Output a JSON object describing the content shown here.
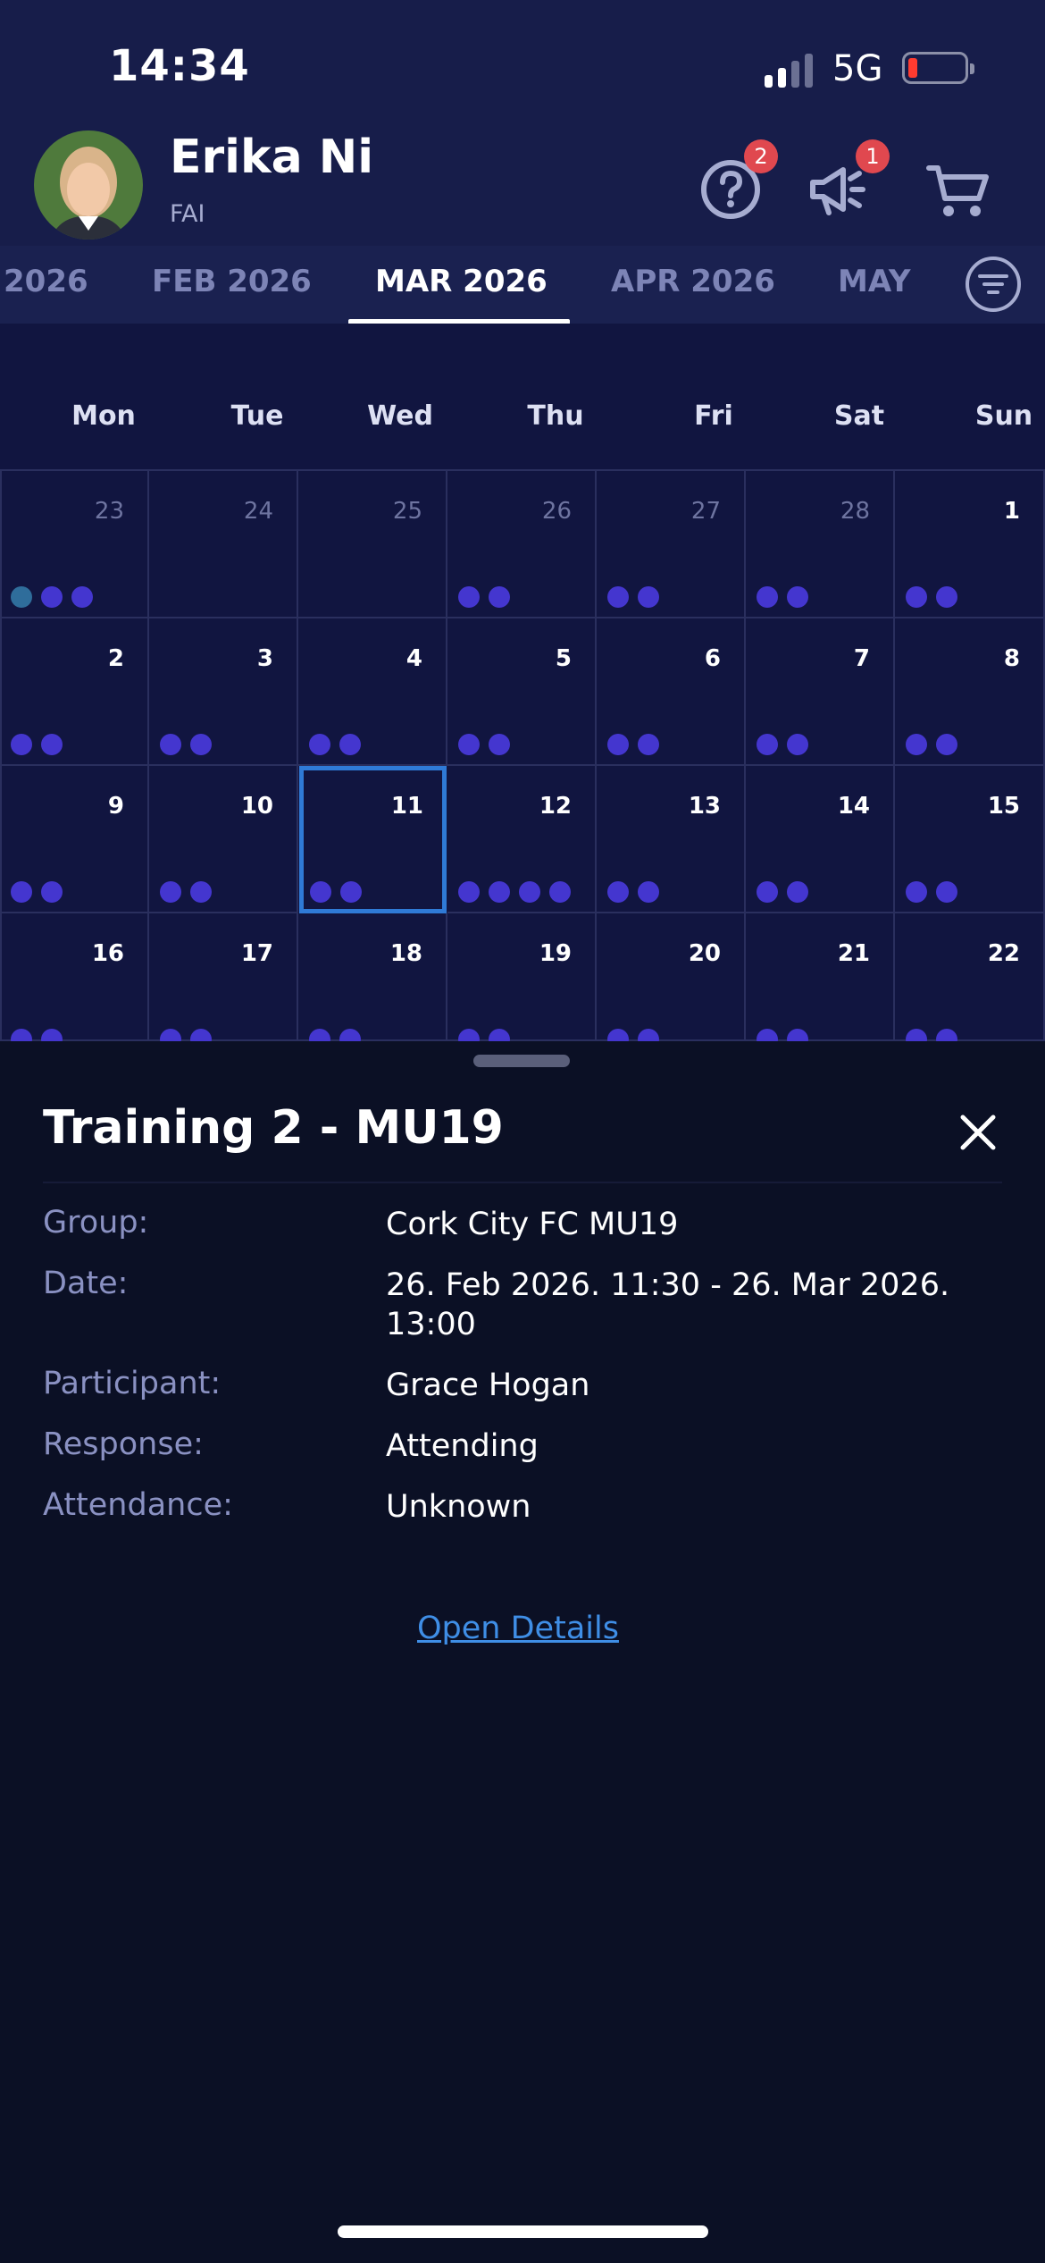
{
  "status_bar": {
    "time": "14:34",
    "network": "5G"
  },
  "user": {
    "name": "Erika Ni",
    "org": "FAI"
  },
  "header_icons": {
    "help_badge": "2",
    "announcements_badge": "1",
    "icons": [
      "help-circle-icon",
      "megaphone-icon",
      "cart-icon"
    ]
  },
  "months": [
    "2026",
    "FEB 2026",
    "MAR 2026",
    "APR 2026",
    "MAY"
  ],
  "active_month": "MAR 2026",
  "weekdays": [
    "Mon",
    "Tue",
    "Wed",
    "Thu",
    "Fri",
    "Sat",
    "Sun"
  ],
  "calendar": {
    "weeks": [
      [
        {
          "d": "23",
          "o": true,
          "dots": 3
        },
        {
          "d": "24",
          "o": true,
          "dots": 0
        },
        {
          "d": "25",
          "o": true,
          "dots": 0
        },
        {
          "d": "26",
          "o": true,
          "dots": 2
        },
        {
          "d": "27",
          "o": true,
          "dots": 2
        },
        {
          "d": "28",
          "o": true,
          "dots": 2
        },
        {
          "d": "1",
          "o": false,
          "dots": 2
        }
      ],
      [
        {
          "d": "2",
          "dots": 2
        },
        {
          "d": "3",
          "dots": 2
        },
        {
          "d": "4",
          "dots": 2
        },
        {
          "d": "5",
          "dots": 2
        },
        {
          "d": "6",
          "dots": 2
        },
        {
          "d": "7",
          "dots": 2
        },
        {
          "d": "8",
          "dots": 2
        }
      ],
      [
        {
          "d": "9",
          "dots": 2
        },
        {
          "d": "10",
          "dots": 2
        },
        {
          "d": "11",
          "dots": 2,
          "sel": true
        },
        {
          "d": "12",
          "dots": 4
        },
        {
          "d": "13",
          "dots": 2
        },
        {
          "d": "14",
          "dots": 2
        },
        {
          "d": "15",
          "dots": 2
        }
      ],
      [
        {
          "d": "16",
          "dots": 2
        },
        {
          "d": "17",
          "dots": 2
        },
        {
          "d": "18",
          "dots": 2
        },
        {
          "d": "19",
          "dots": 2
        },
        {
          "d": "20",
          "dots": 2
        },
        {
          "d": "21",
          "dots": 2
        },
        {
          "d": "22",
          "dots": 2
        }
      ]
    ],
    "colors": {
      "dot": "#4436cf",
      "dot_alt": "#2f6d9b",
      "selected_border": "#2f7ad6"
    }
  },
  "detail": {
    "title": "Training 2 - MU19",
    "rows": [
      {
        "label": "Group:",
        "value": "Cork City FC MU19"
      },
      {
        "label": "Date:",
        "value": "26. Feb 2026. 11:30 - 26. Mar 2026. 13:00"
      },
      {
        "label": "Participant:",
        "value": "Grace Hogan"
      },
      {
        "label": "Response:",
        "value": "Attending"
      },
      {
        "label": "Attendance:",
        "value": "Unknown"
      }
    ],
    "link": "Open Details"
  }
}
